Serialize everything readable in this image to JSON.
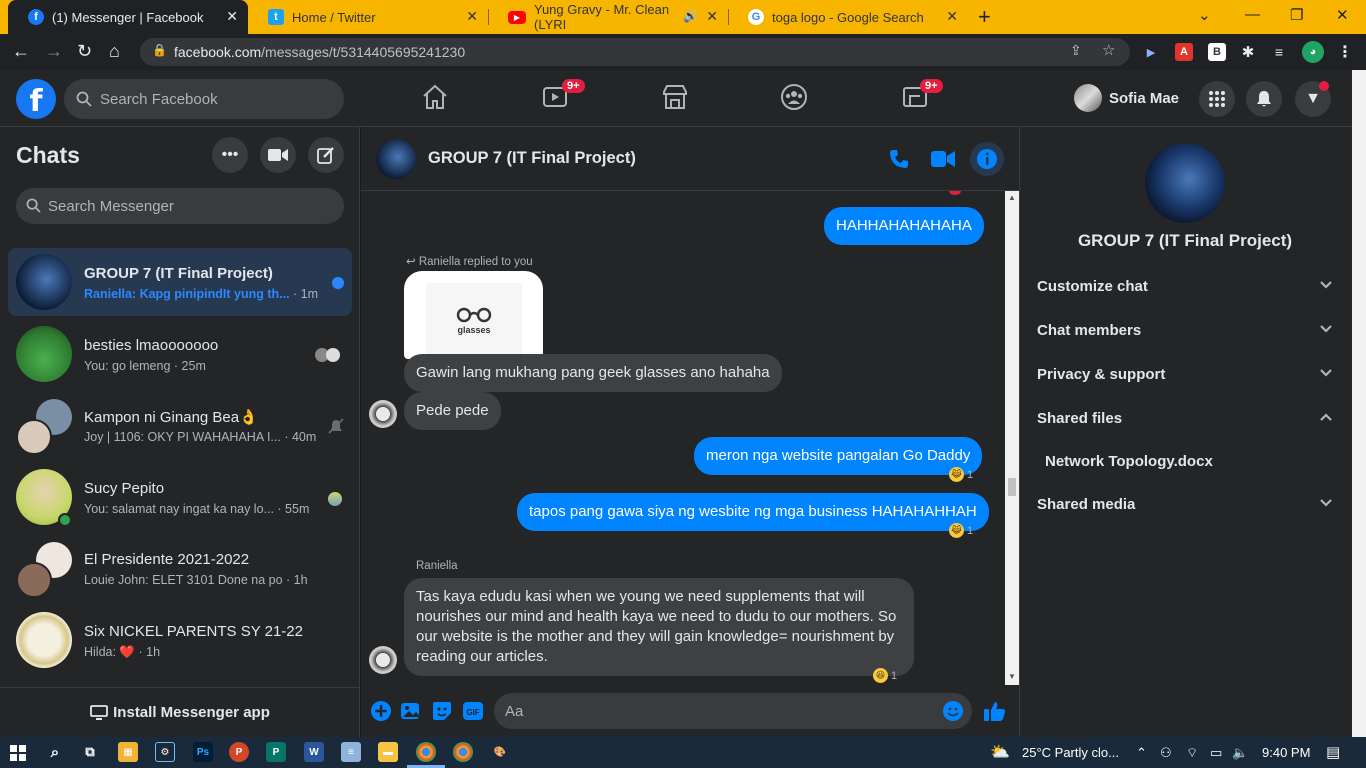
{
  "browser": {
    "tabs": [
      {
        "title": "(1) Messenger | Facebook",
        "active": true
      },
      {
        "title": "Home / Twitter",
        "active": false
      },
      {
        "title": "Yung Gravy - Mr. Clean (LYRI",
        "active": false
      },
      {
        "title": "toga logo - Google Search",
        "active": false
      }
    ],
    "new_tab": "+",
    "url_domain": "facebook.com",
    "url_path": "/messages/t/5314405695241230"
  },
  "fb": {
    "search_placeholder": "Search Facebook",
    "watch_badge": "9+",
    "gaming_badge": "9+",
    "profile_name": "Sofia Mae"
  },
  "chats": {
    "title": "Chats",
    "search_placeholder": "Search Messenger",
    "items": [
      {
        "name": "GROUP 7 (IT Final Project)",
        "preview": "Raniella: Kapg pinipindIt yung th...",
        "time": "· 1m"
      },
      {
        "name": "besties lmaooooooo",
        "preview": "You: go lemeng",
        "time": "· 25m"
      },
      {
        "name": "Kampon ni Ginang Bea👌",
        "preview": "Joy | 1106: OKY PI WAHAHAHA I...",
        "time": "· 40m"
      },
      {
        "name": "Sucy Pepito",
        "preview": "You: salamat nay ingat ka nay lo...",
        "time": "· 55m"
      },
      {
        "name": "El Presidente 2021-2022",
        "preview": "Louie John: ELET 3101 Done na po",
        "time": "· 1h"
      },
      {
        "name": "Six NICKEL PARENTS SY 21-22",
        "preview": "Hilda: ❤️",
        "time": "· 1h"
      }
    ],
    "install_label": "Install Messenger app"
  },
  "conversation": {
    "title": "GROUP 7 (IT Final Project)",
    "messages": {
      "m1": "HAHHAHAHAHAHA",
      "reply_note": "Raniella replied to you",
      "glasses_logo_text": "glasses",
      "m2": "Gawin lang mukhang pang geek glasses ano hahaha",
      "m3": "Pede pede",
      "m4": "meron nga website pangalan Go Daddy",
      "m4_react_count": "1",
      "m5": "tapos pang gawa siya ng wesbite ng mga business HAHAHAHHAH",
      "m5_react_count": "1",
      "sender": "Raniella",
      "m6_l1": "Tas kaya edudu kasi when we young we need supplements that will",
      "m6_l2": "nourishes our mind and health kaya we need to dudu to our mothers. So",
      "m6_l3": "our website is the mother and they will gain knowledge= nourishment by",
      "m6_l4": "reading our articles.",
      "m6_react_count": "1"
    },
    "composer_placeholder": "Aa"
  },
  "info": {
    "title": "GROUP 7 (IT Final Project)",
    "sections": {
      "customize": "Customize chat",
      "members": "Chat members",
      "privacy": "Privacy & support",
      "shared_files": "Shared files",
      "file1": "Network Topology.docx",
      "shared_media": "Shared media"
    }
  },
  "taskbar": {
    "weather": "25°C  Partly clo...",
    "time": "9:40 PM"
  },
  "colors": {
    "accent": "#0084ff",
    "tab_strip": "#f7b500",
    "fb_blue": "#1877f2",
    "badge": "#e41e3f"
  }
}
